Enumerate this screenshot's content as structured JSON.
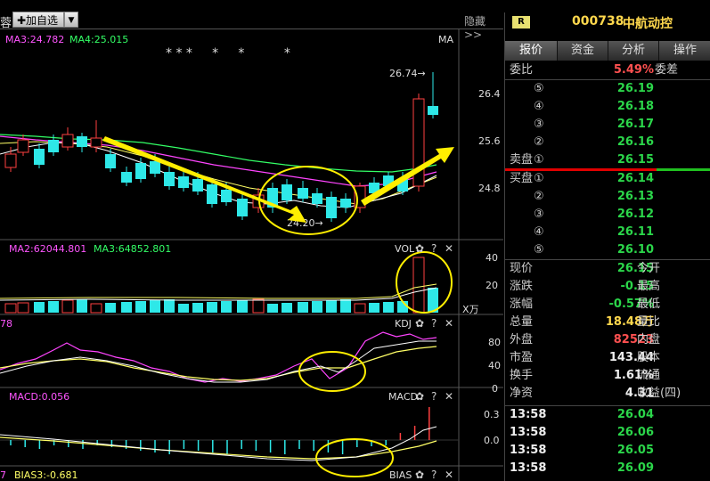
{
  "toolbar": {
    "left_char": "蓉",
    "add_label": "✚加自选",
    "dropdown": "▼",
    "hide_label": "隐藏>>"
  },
  "main": {
    "ma3": "MA3:24.782",
    "ma4": "MA4:25.015",
    "ma_tag": "MA",
    "stars": "* * *     *     *          *",
    "price_labels": [
      "26.4",
      "25.6",
      "24.8"
    ],
    "high_label": "26.74→",
    "low_label": "24.20→"
  },
  "vol": {
    "ma2": "MA2:62044.801",
    "ma3": "MA3:64852.801",
    "tag": "VOL",
    "ticks": [
      "40",
      "20"
    ],
    "unit": "X万"
  },
  "kdj": {
    "left": "78",
    "tag": "KDJ",
    "ticks": [
      "80",
      "40",
      "0"
    ]
  },
  "macd": {
    "left": "MACD:0.056",
    "tag": "MACD",
    "ticks": [
      "0.3",
      "0.0"
    ]
  },
  "bias": {
    "left": "BIAS3:-0.681",
    "first": "7",
    "tag": "BIAS"
  },
  "ctrl": {
    "gear": "✿",
    "help": "?",
    "close": "✕"
  },
  "panel": {
    "badge": "R",
    "code": "000738",
    "name": "中航动控",
    "tabs": [
      "报价",
      "资金",
      "分析",
      "操作"
    ],
    "weibi_label": "委比",
    "weibi_value": "5.49%",
    "weicha_label": "委差",
    "sell_label": "卖盘",
    "buy_label": "买盘",
    "sell": [
      {
        "idx": "⑤",
        "price": "26.19"
      },
      {
        "idx": "④",
        "price": "26.18"
      },
      {
        "idx": "③",
        "price": "26.17"
      },
      {
        "idx": "②",
        "price": "26.16"
      },
      {
        "idx": "①",
        "price": "26.15"
      }
    ],
    "buy": [
      {
        "idx": "①",
        "price": "26.14"
      },
      {
        "idx": "②",
        "price": "26.13"
      },
      {
        "idx": "③",
        "price": "26.12"
      },
      {
        "idx": "④",
        "price": "26.11"
      },
      {
        "idx": "⑤",
        "price": "26.10"
      }
    ],
    "stats": [
      {
        "label": "现价",
        "value": "26.15",
        "color": "green",
        "label2": "今开"
      },
      {
        "label": "涨跌",
        "value": "-0.15",
        "color": "green",
        "label2": "最高"
      },
      {
        "label": "涨幅",
        "value": "-0.57%",
        "color": "green",
        "label2": "最低"
      },
      {
        "label": "总量",
        "value": "18.48万",
        "color": "yellow",
        "label2": "量比"
      },
      {
        "label": "外盘",
        "value": "82523",
        "color": "red",
        "label2": "内盘"
      },
      {
        "label": "市盈",
        "value": "143.44",
        "color": "white",
        "label2": "股本"
      },
      {
        "label": "换手",
        "value": "1.61%",
        "color": "white",
        "label2": "流通"
      },
      {
        "label": "净资",
        "value": "4.31",
        "color": "white",
        "label2": "收益(四)"
      }
    ],
    "ticks": [
      {
        "time": "13:58",
        "price": "26.04"
      },
      {
        "time": "13:58",
        "price": "26.06"
      },
      {
        "time": "13:58",
        "price": "26.05"
      },
      {
        "time": "13:58",
        "price": "26.09"
      }
    ]
  }
}
